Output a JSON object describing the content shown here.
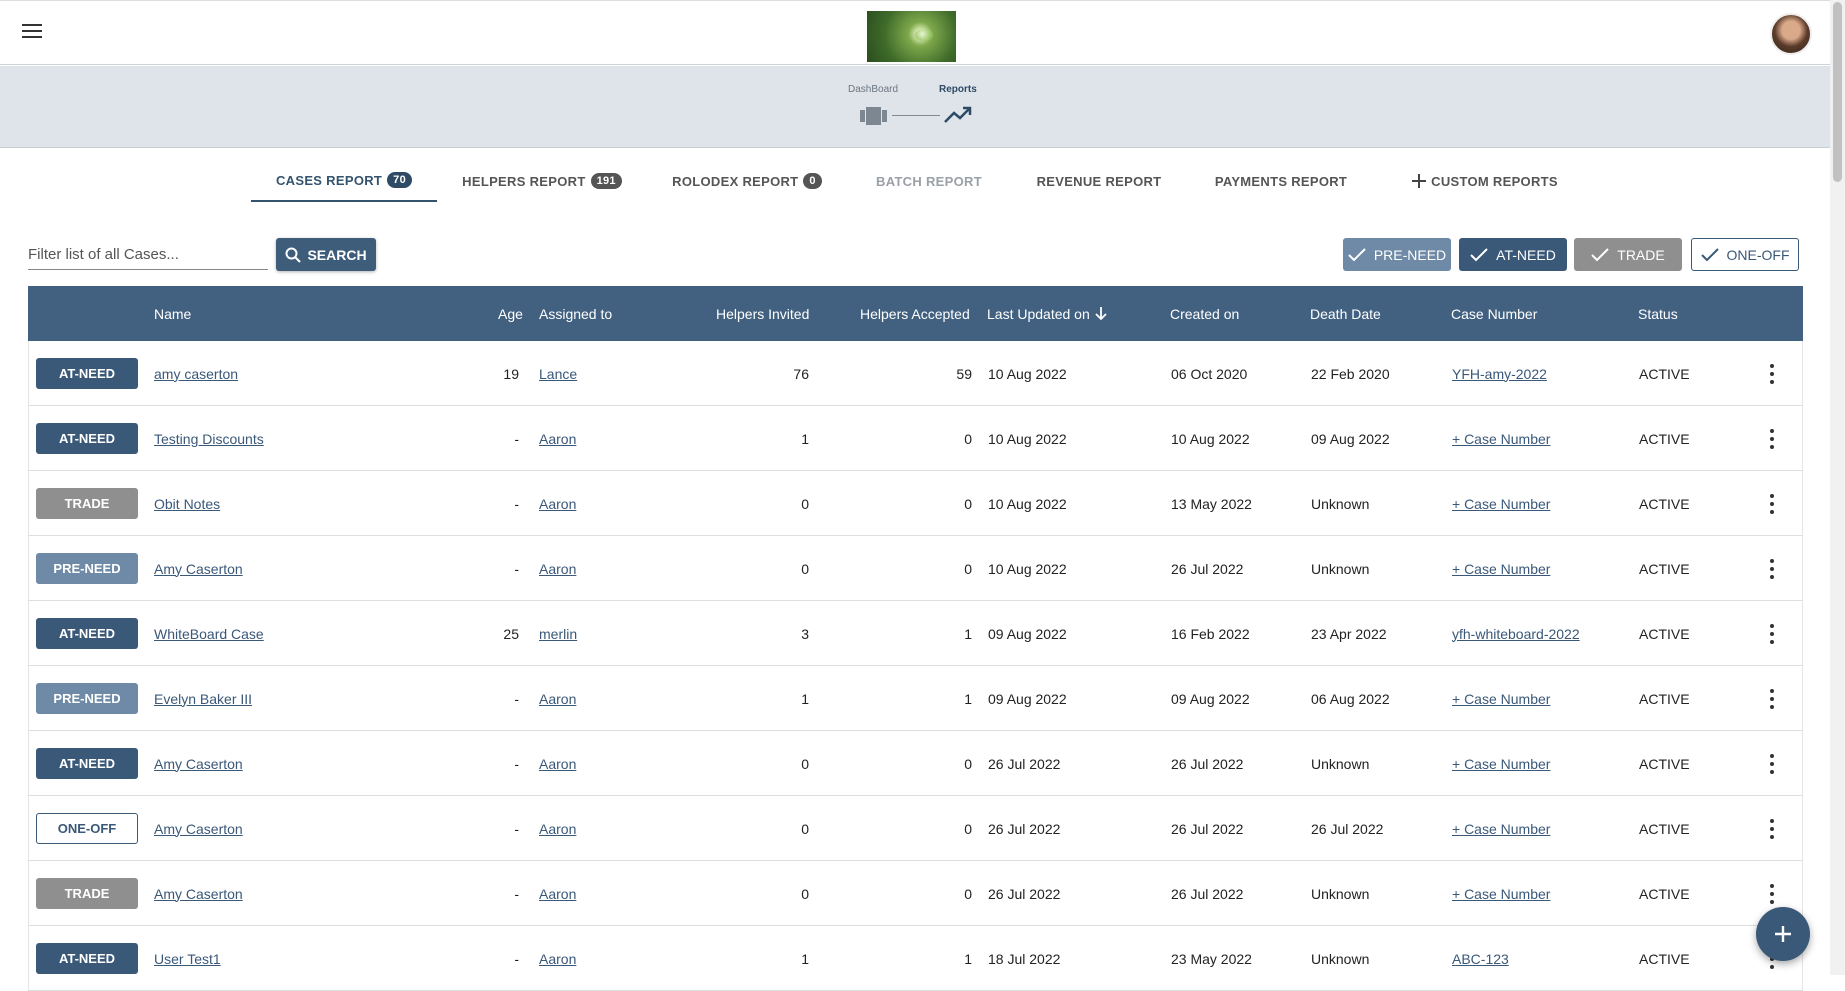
{
  "stepper": {
    "steps": [
      {
        "label": "DashBoard"
      },
      {
        "label": "Reports"
      }
    ]
  },
  "tabs": [
    {
      "label": "CASES REPORT",
      "badge": "70"
    },
    {
      "label": "HELPERS REPORT",
      "badge": "191"
    },
    {
      "label": "ROLODEX REPORT",
      "badge": "0"
    },
    {
      "label": "BATCH REPORT",
      "badge": ""
    },
    {
      "label": "REVENUE REPORT",
      "badge": ""
    },
    {
      "label": "PAYMENTS REPORT",
      "badge": ""
    },
    {
      "label": "CUSTOM REPORTS",
      "badge": ""
    }
  ],
  "filter": {
    "placeholder": "Filter list of all Cases...",
    "value": "",
    "search_label": "SEARCH"
  },
  "chips": {
    "preneed": "PRE-NEED",
    "atneed": "AT-NEED",
    "trade": "TRADE",
    "oneoff": "ONE-OFF"
  },
  "table": {
    "headers": {
      "name": "Name",
      "age": "Age",
      "assigned": "Assigned to",
      "invited": "Helpers Invited",
      "accepted": "Helpers Accepted",
      "updated": "Last Updated on",
      "created": "Created on",
      "death": "Death Date",
      "case": "Case Number",
      "status": "Status"
    },
    "rows": [
      {
        "type": "AT-NEED",
        "name": "amy caserton",
        "age": "19",
        "assigned": "Lance",
        "invited": "76",
        "accepted": "59",
        "updated": "10 Aug 2022",
        "created": "06 Oct 2020",
        "death": "22 Feb 2020",
        "case": "YFH-amy-2022",
        "status": "ACTIVE"
      },
      {
        "type": "AT-NEED",
        "name": "Testing Discounts",
        "age": "-",
        "assigned": "Aaron",
        "invited": "1",
        "accepted": "0",
        "updated": "10 Aug 2022",
        "created": "10 Aug 2022",
        "death": "09 Aug 2022",
        "case": "+ Case Number",
        "status": "ACTIVE"
      },
      {
        "type": "TRADE",
        "name": "Obit Notes",
        "age": "-",
        "assigned": "Aaron",
        "invited": "0",
        "accepted": "0",
        "updated": "10 Aug 2022",
        "created": "13 May 2022",
        "death": "Unknown",
        "case": "+ Case Number",
        "status": "ACTIVE"
      },
      {
        "type": "PRE-NEED",
        "name": "Amy Caserton",
        "age": "-",
        "assigned": "Aaron",
        "invited": "0",
        "accepted": "0",
        "updated": "10 Aug 2022",
        "created": "26 Jul 2022",
        "death": "Unknown",
        "case": "+ Case Number",
        "status": "ACTIVE"
      },
      {
        "type": "AT-NEED",
        "name": "WhiteBoard Case",
        "age": "25",
        "assigned": "merlin",
        "invited": "3",
        "accepted": "1",
        "updated": "09 Aug 2022",
        "created": "16 Feb 2022",
        "death": "23 Apr 2022",
        "case": "yfh-whiteboard-2022",
        "status": "ACTIVE"
      },
      {
        "type": "PRE-NEED",
        "name": "Evelyn Baker III",
        "age": "-",
        "assigned": "Aaron",
        "invited": "1",
        "accepted": "1",
        "updated": "09 Aug 2022",
        "created": "09 Aug 2022",
        "death": "06 Aug 2022",
        "case": "+ Case Number",
        "status": "ACTIVE"
      },
      {
        "type": "AT-NEED",
        "name": "Amy Caserton",
        "age": "-",
        "assigned": "Aaron",
        "invited": "0",
        "accepted": "0",
        "updated": "26 Jul 2022",
        "created": "26 Jul 2022",
        "death": "Unknown",
        "case": "+ Case Number",
        "status": "ACTIVE"
      },
      {
        "type": "ONE-OFF",
        "name": "Amy Caserton",
        "age": "-",
        "assigned": "Aaron",
        "invited": "0",
        "accepted": "0",
        "updated": "26 Jul 2022",
        "created": "26 Jul 2022",
        "death": "26 Jul 2022",
        "case": "+ Case Number",
        "status": "ACTIVE"
      },
      {
        "type": "TRADE",
        "name": "Amy Caserton",
        "age": "-",
        "assigned": "Aaron",
        "invited": "0",
        "accepted": "0",
        "updated": "26 Jul 2022",
        "created": "26 Jul 2022",
        "death": "Unknown",
        "case": "+ Case Number",
        "status": "ACTIVE"
      },
      {
        "type": "AT-NEED",
        "name": "User Test1",
        "age": "-",
        "assigned": "Aaron",
        "invited": "1",
        "accepted": "1",
        "updated": "18 Jul 2022",
        "created": "23 May 2022",
        "death": "Unknown",
        "case": "ABC-123",
        "status": "ACTIVE"
      }
    ]
  }
}
